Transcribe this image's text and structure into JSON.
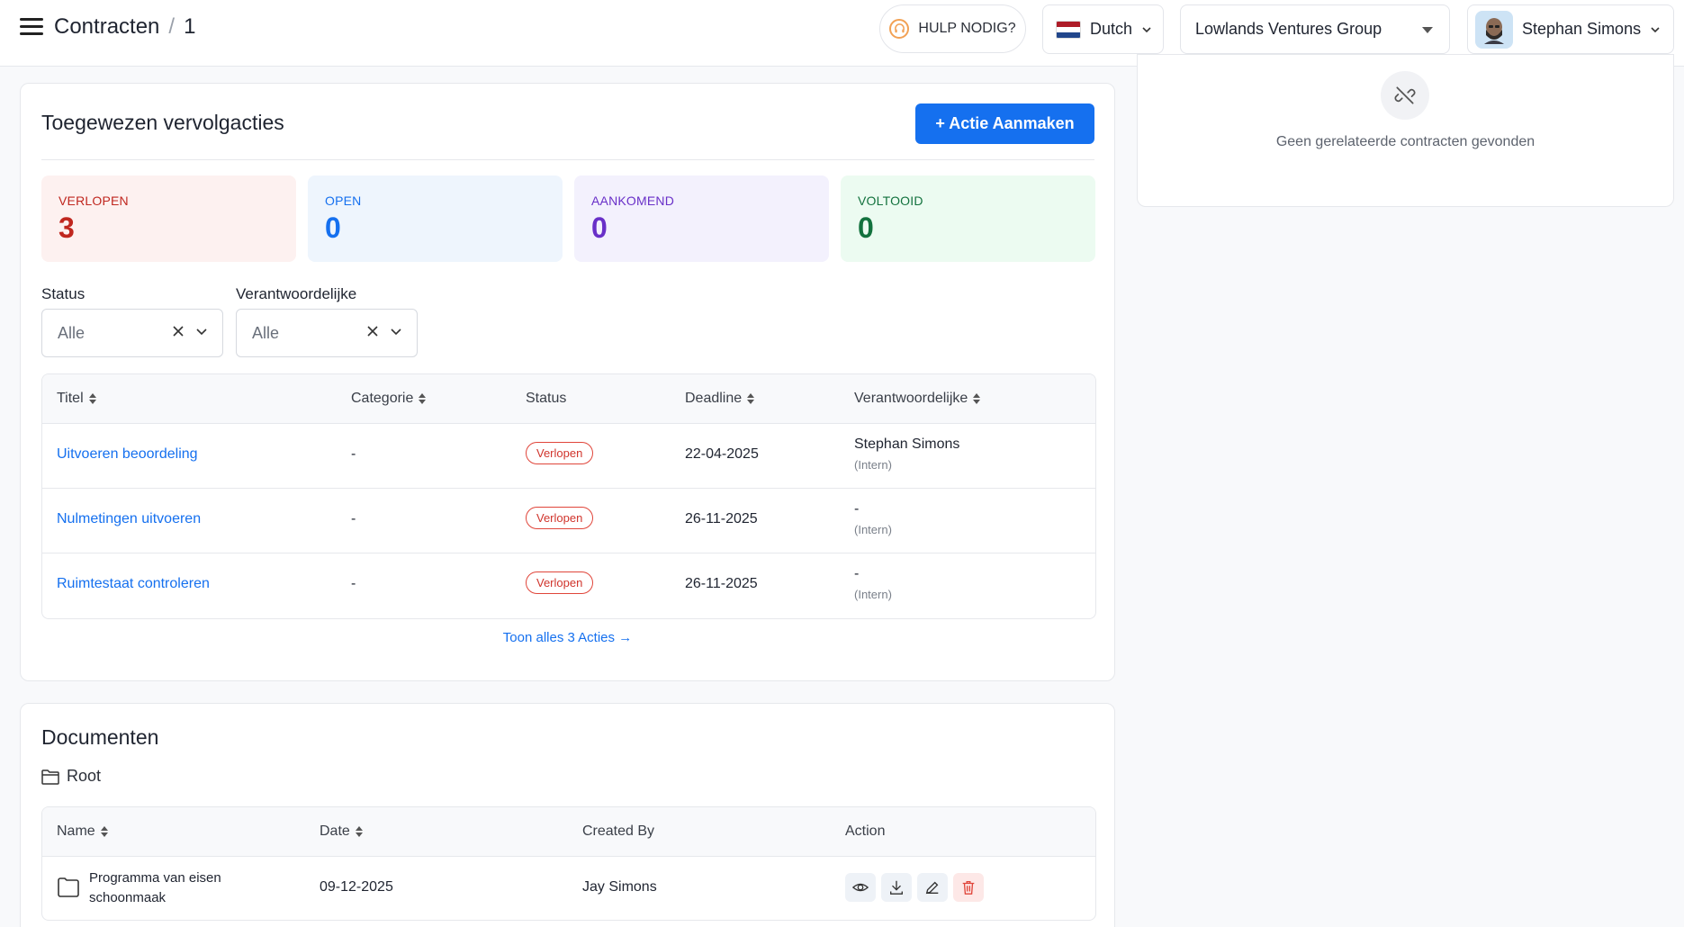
{
  "header": {
    "crumb_title": "Contracten",
    "crumb_sep": "/",
    "crumb_id": "1",
    "help_label": "HULP NODIG?",
    "language": "Dutch",
    "organization": "Lowlands Ventures Group",
    "user_name": "Stephan Simons"
  },
  "acties": {
    "title": "Toegewezen vervolgacties",
    "create_button": "+ Actie Aanmaken",
    "stats": [
      {
        "label": "VERLOPEN",
        "value": "3",
        "bg": "#fdf1f0",
        "color": "#c0271f"
      },
      {
        "label": "OPEN",
        "value": "0",
        "bg": "#eef5fd",
        "color": "#1570ef"
      },
      {
        "label": "AANKOMEND",
        "value": "0",
        "bg": "#f3f1fd",
        "color": "#6930c8"
      },
      {
        "label": "VOLTOOID",
        "value": "0",
        "bg": "#ecfbf1",
        "color": "#13723e"
      }
    ],
    "filters": {
      "status_label": "Status",
      "status_value": "Alle",
      "owner_label": "Verantwoordelijke",
      "owner_value": "Alle"
    },
    "columns": [
      "Titel",
      "Categorie",
      "Status",
      "Deadline",
      "Verantwoordelijke"
    ],
    "rows": [
      {
        "title": "Uitvoeren beoordeling",
        "category": "-",
        "status": "Verlopen",
        "deadline": "22-04-2025",
        "owner": "Stephan Simons",
        "owner_type": "(Intern)"
      },
      {
        "title": "Nulmetingen uitvoeren",
        "category": "-",
        "status": "Verlopen",
        "deadline": "26-11-2025",
        "owner": "-",
        "owner_type": "(Intern)"
      },
      {
        "title": "Ruimtestaat controleren",
        "category": "-",
        "status": "Verlopen",
        "deadline": "26-11-2025",
        "owner": "-",
        "owner_type": "(Intern)"
      }
    ],
    "show_all": "Toon alles 3 Acties →"
  },
  "related": {
    "empty_text": "Geen gerelateerde contracten gevonden"
  },
  "documents": {
    "title": "Documenten",
    "folder": "Root",
    "columns": [
      "Name",
      "Date",
      "Created By",
      "Action"
    ],
    "rows": [
      {
        "name_line1": "Programma van eisen",
        "name_line2": "schoonmaak",
        "date": "09-12-2025",
        "created_by": "Jay Simons"
      }
    ]
  }
}
